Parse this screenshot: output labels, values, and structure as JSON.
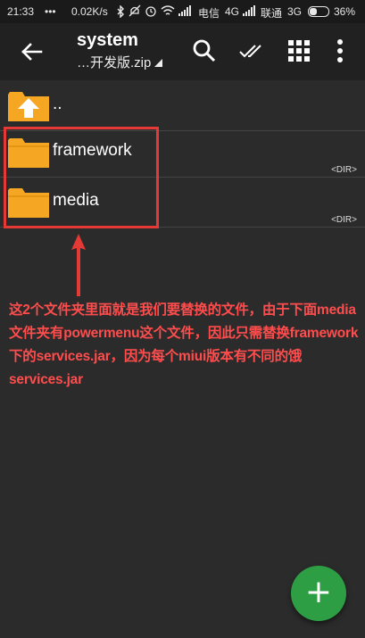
{
  "statusbar": {
    "time": "21:33",
    "dots": "•••",
    "speed": "0.02K/s",
    "carrier1": "电信",
    "net1": "4G",
    "carrier2": "联通",
    "net2": "3G",
    "battery": "36%"
  },
  "appbar": {
    "title": "system",
    "subtitle": "…开发版.zip",
    "icons": [
      "back-arrow-icon",
      "search-icon",
      "double-check-icon",
      "grid-icon",
      "more-vert-icon"
    ]
  },
  "list": {
    "parent_label": "..",
    "items": [
      {
        "name": "framework",
        "type": "<DIR>"
      },
      {
        "name": "media",
        "type": "<DIR>"
      }
    ]
  },
  "annotation": {
    "text": "这2个文件夹里面就是我们要替换的文件，由于下面media文件夹有powermenu这个文件，因此只需替换framework下的services.jar，因为每个miui版本有不同的饿services.jar",
    "color": "#ff4d4d"
  },
  "fab": {
    "label": "+",
    "color": "#2e9e44"
  },
  "colors": {
    "folder": "#f5a623",
    "highlight": "#e53935"
  }
}
